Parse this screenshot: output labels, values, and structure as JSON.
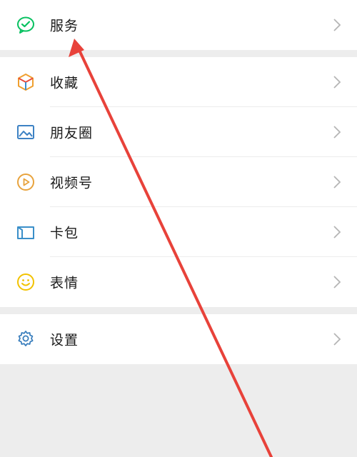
{
  "menu": {
    "groups": [
      {
        "items": [
          {
            "label": "服务",
            "icon": "wechat-pay-check-icon",
            "icon_color": "#07c160"
          }
        ]
      },
      {
        "items": [
          {
            "label": "收藏",
            "icon": "cube-icon",
            "icon_color": "#f0a030"
          },
          {
            "label": "朋友圈",
            "icon": "image-icon",
            "icon_color": "#3d82c4"
          },
          {
            "label": "视频号",
            "icon": "play-circle-icon",
            "icon_color": "#e8a33d"
          },
          {
            "label": "卡包",
            "icon": "wallet-icon",
            "icon_color": "#3a8fc9"
          },
          {
            "label": "表情",
            "icon": "smiley-icon",
            "icon_color": "#f2c200"
          }
        ]
      },
      {
        "items": [
          {
            "label": "设置",
            "icon": "gear-icon",
            "icon_color": "#3b7fbd"
          }
        ]
      }
    ],
    "chevron_icon": "chevron-right-icon"
  },
  "overlay": {
    "annotation": "red-arrow-pointing-to-services",
    "color": "#e8423a"
  }
}
